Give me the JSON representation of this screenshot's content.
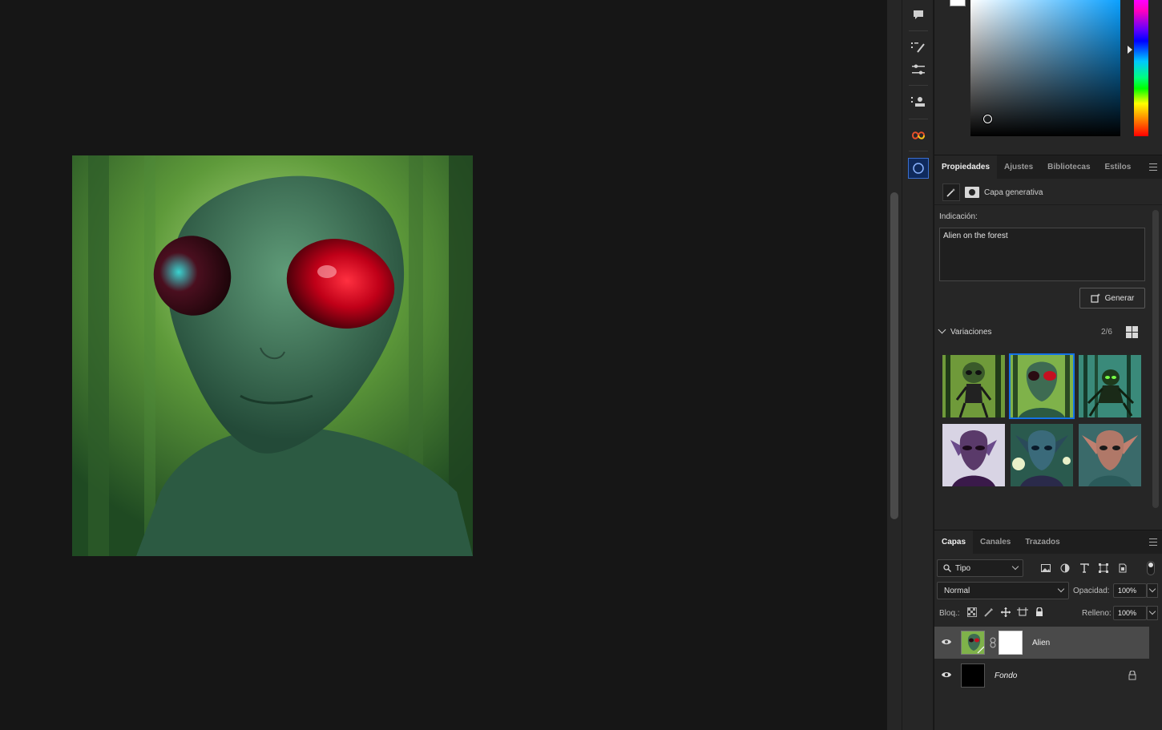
{
  "canvas": {
    "image_subject": "alien-portrait"
  },
  "properties_panel": {
    "tabs": [
      "Propiedades",
      "Ajustes",
      "Bibliotecas",
      "Estilos"
    ],
    "layer_type": "Capa generativa",
    "prompt_label": "Indicación:",
    "prompt_text": "Alien on the forest",
    "generate_label": "Generar",
    "variations_label": "Variaciones",
    "variations_count": "2/6"
  },
  "layers_panel": {
    "tabs": [
      "Capas",
      "Canales",
      "Trazados"
    ],
    "filter_value": "Tipo",
    "blend_mode": "Normal",
    "opacity_label": "Opacidad:",
    "opacity_value": "100%",
    "lock_label": "Bloq.:",
    "fill_label": "Relleno:",
    "fill_value": "100%",
    "layers": [
      {
        "name": "Alien",
        "selected": true
      },
      {
        "name": "Fondo",
        "selected": false
      }
    ]
  },
  "colors": {
    "accent": "#1473e6",
    "panel_bg": "#262626",
    "canvas_bg": "#161616"
  }
}
